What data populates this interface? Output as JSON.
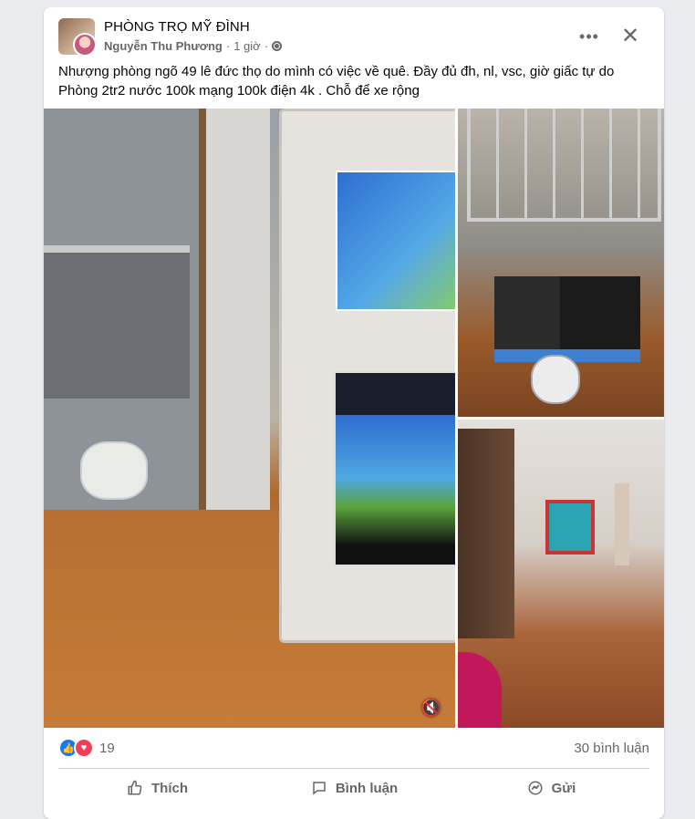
{
  "post": {
    "group_name": "PHÒNG TRỌ MỸ ĐÌNH",
    "author": "Nguyễn Thu Phương",
    "separator": "·",
    "time": "1 giờ",
    "text_line1": "Nhượng phòng ngõ 49 lê đức thọ do mình có việc về quê. Đầy đủ đh, nl, vsc, giờ giấc tự do",
    "text_line2": "Phòng 2tr2 nước 100k mạng 100k điện 4k . Chỗ để xe rộng"
  },
  "header_actions": {
    "more_icon": "ellipsis-icon",
    "close_icon": "close-icon"
  },
  "reactions": {
    "count": "19",
    "comments": "30 bình luận",
    "types": [
      "like",
      "love"
    ]
  },
  "actions": {
    "like_label": "Thích",
    "comment_label": "Bình luận",
    "send_label": "Gửi"
  },
  "colors": {
    "accent": "#1877f2",
    "love": "#f33e58",
    "secondary_text": "#65676b"
  }
}
